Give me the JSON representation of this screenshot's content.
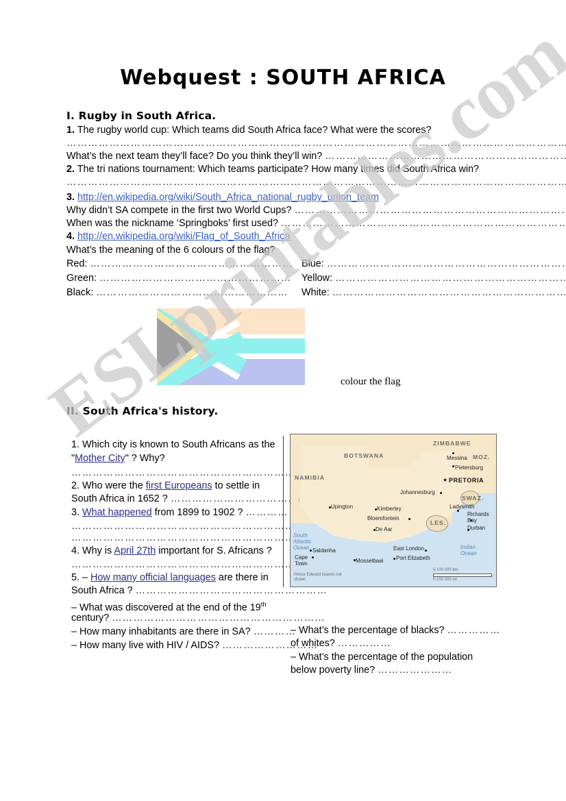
{
  "document": {
    "title": "Webquest : SOUTH AFRICA",
    "watermark": "ESLprintables.com"
  },
  "section_1": {
    "heading": "I. Rugby in South Africa.",
    "items": [
      {
        "num": "1.",
        "text": "The rugby world cup: Which teams did South Africa face? What were the scores?"
      },
      {
        "answer_line": "…………………………………………………………………………………………………………………………………………………"
      },
      {
        "text": "What’s the next team they’ll face? Do you think they’ll win?",
        "dots": "………………………………………………………………"
      },
      {
        "num": "2.",
        "text": "The tri nations tournament: Which teams participate? How many times did South Africa win?"
      },
      {
        "answer_line": "…………………………………………………………………………………………………………………………………………………"
      },
      {
        "num": "3.",
        "link": "http://en.wikipedia.org/wiki/South_Africa_national_rugby_union_team"
      },
      {
        "text": "Why didn’t SA compete in the first two World Cups?",
        "dots": "………………………………………………………………………"
      },
      {
        "text": "When was the nickname ‘Springboks’ first used?",
        "dots": "……………………………………………………………………………"
      },
      {
        "num": "4.",
        "link": "http://en.wikipedia.org/wiki/Flag_of_South_Africa"
      },
      {
        "text": "What’s the meaning of the 6 colours of the flag?"
      }
    ],
    "colours": {
      "left": [
        {
          "label": "Red:",
          "dots": "…………………………………………………"
        },
        {
          "label": "Green:",
          "dots": "………………………………………………"
        },
        {
          "label": "Black:",
          "dots": "………………………………………………"
        }
      ],
      "right": [
        {
          "label": "Blue:",
          "dots": "………………………………………………………………"
        },
        {
          "label": "Yellow:",
          "dots": "……………………………………………………………"
        },
        {
          "label": "White:",
          "dots": "……………………………………………………………"
        }
      ]
    },
    "flag_caption": "colour the flag"
  },
  "section_2": {
    "heading": "II. South Africa's history.",
    "left_column": [
      {
        "num": "1.",
        "pre": "Which city is known to South Africans as the",
        "link": "",
        "post": ""
      },
      {
        "quote_open": "\"",
        "link": "Mother City",
        "quote_close": "\" ? Why?"
      },
      {
        "answer_line": "……………………………………………………………………………"
      },
      {
        "num": "2.",
        "pre": "Who were the ",
        "link": "first Europeans",
        "post": " to settle in"
      },
      {
        "pre": "South Africa in 1652 ?",
        "dots": "………………………………………"
      },
      {
        "num": "3.",
        "link": "What happened",
        "post": " from 1899 to 1902 ?",
        "dots": "……………"
      },
      {
        "answer_line": "……………………………………………………………………………"
      },
      {
        "answer_line": "……………………………………………………………………………"
      },
      {
        "num": "4.",
        "pre": "Why is ",
        "link": "April 27th",
        "post": " important for S. Africans ?"
      },
      {
        "answer_line": "……………………………………………………………………"
      },
      {
        "num": "5. –",
        "link": "How many official languages",
        "post": " are there in"
      },
      {
        "pre": "South Africa ?",
        "dots": "………………………………………………"
      },
      {
        "pre": "– What was discovered at the end of the 19",
        "sup": "th"
      },
      {
        "pre": "century?",
        "dots": "……………………………………………………"
      },
      {
        "pre": "– How many inhabitants are there in SA?",
        "dots": "…………"
      },
      {
        "pre": "– How many live with HIV / AIDS?",
        "dots": "………………………"
      }
    ],
    "right_column": [
      {
        "text": "– What’s the percentage of blacks?",
        "dots": "……………"
      },
      {
        "text": "of whites?",
        "dots": "……………"
      },
      {
        "text": "– What’s the percentage of the population"
      },
      {
        "text": "below poverty line?",
        "dots": "…………………"
      }
    ]
  },
  "map": {
    "countries": [
      "NAMIBIA",
      "BOTSWANA",
      "ZIMBABWE",
      "MOZ.",
      "SWAZ.",
      "LES."
    ],
    "capital": "PRETORIA",
    "cities": [
      "Messina",
      "Pietersburg",
      "Johannesburg",
      "Ladysmith",
      "Richards Bay",
      "Durban",
      "Upington",
      "Kimberley",
      "Bloemfontein",
      "De Aar",
      "East London",
      "Port Elizabeth",
      "Mosselbaai",
      "Saldanha",
      "Cape Town"
    ],
    "oceans": [
      "South Atlantic Ocean",
      "Indian Ocean"
    ],
    "note": "Prince Edward Islands not shown",
    "scale_km": "0   100  200 km",
    "scale_mi": "0      100     200 mi"
  },
  "colors": {
    "link_blue": "#3b5fc0",
    "link_navy": "#2b2f87",
    "watermark_gray": "#c9c9c9",
    "flag_pale_red": "#fde3c8",
    "flag_pale_blue": "#b9c2f0",
    "flag_pale_green": "#8ff0ee",
    "flag_pale_gold": "#f6e6a8",
    "flag_pale_black": "#9e9e9e",
    "map_land": "#f7ecd2",
    "map_sea": "#cfe3f2"
  }
}
